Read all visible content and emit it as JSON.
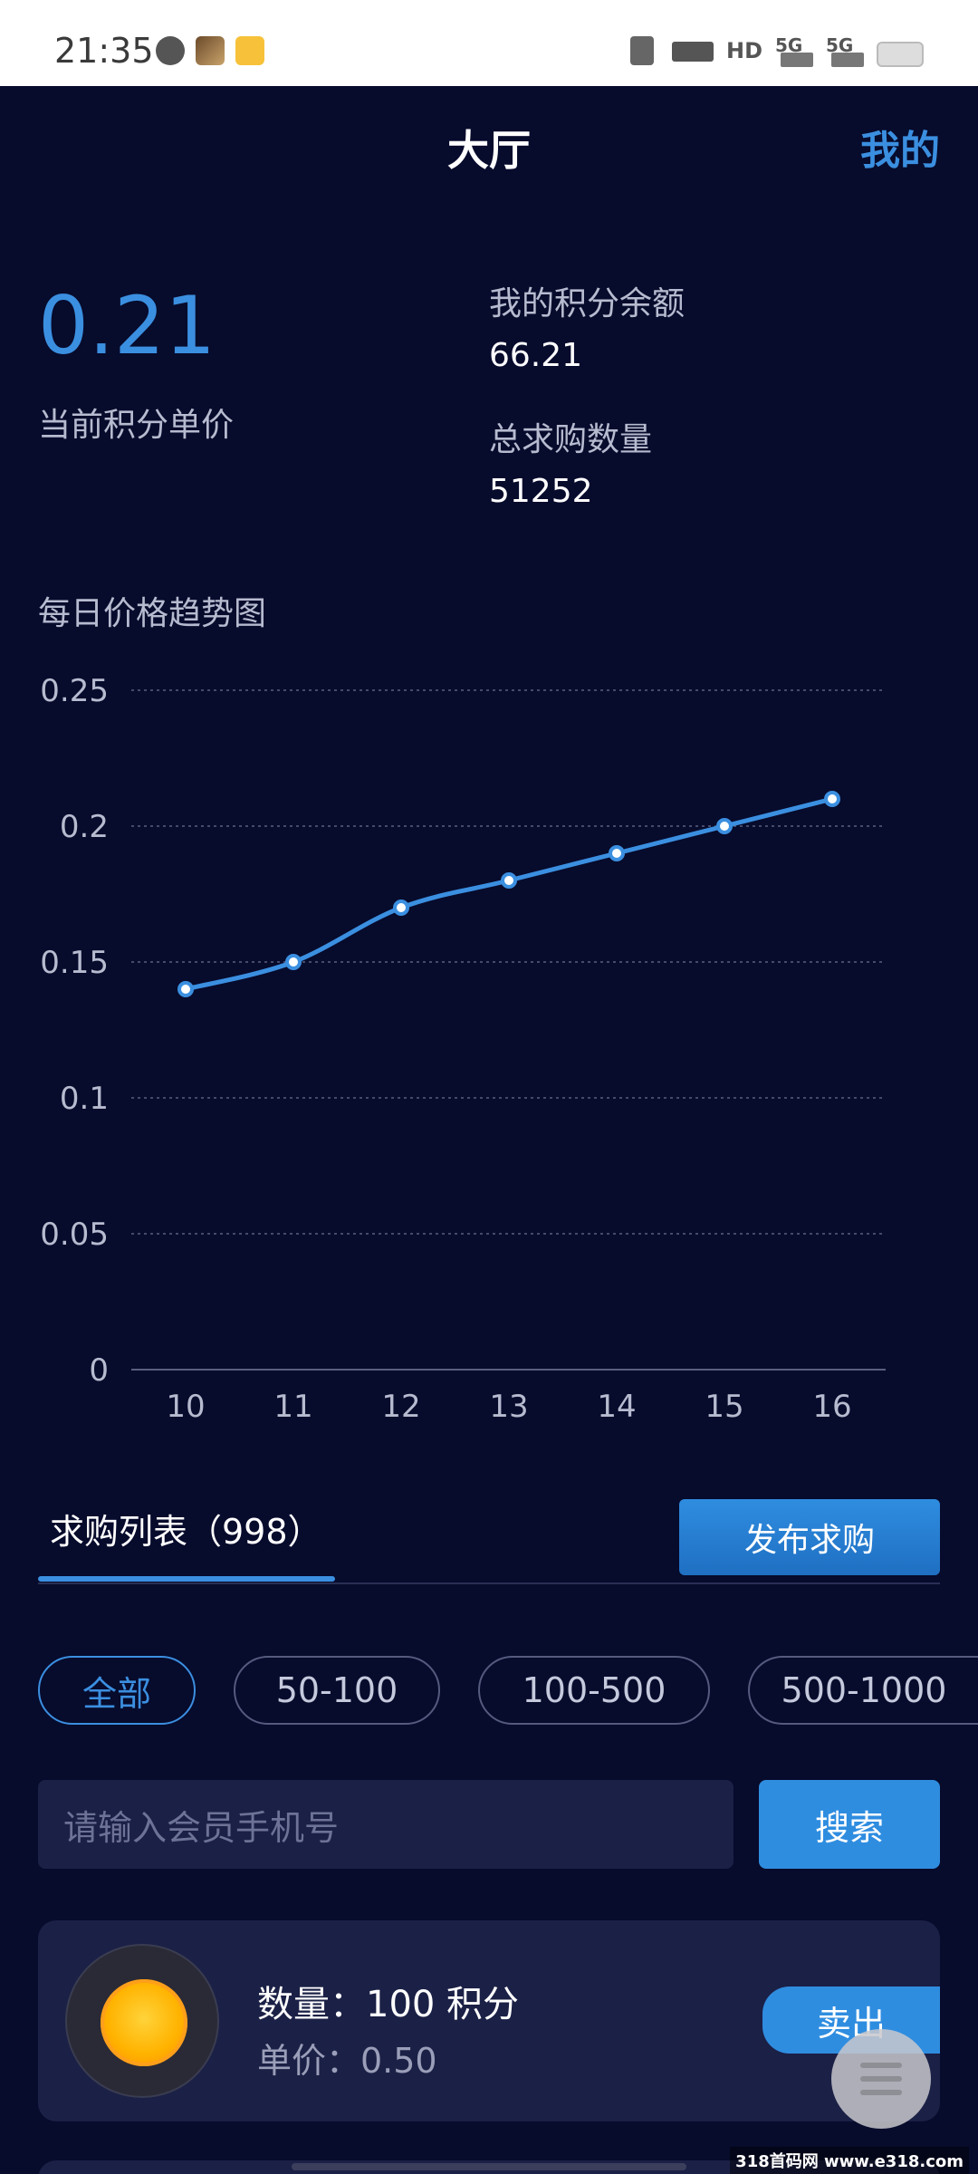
{
  "status_bar": {
    "time": "21:35",
    "network_text": "5G",
    "network_text_2": "5G",
    "hd_text": "HD"
  },
  "nav": {
    "title": "大厅",
    "mine": "我的"
  },
  "summary": {
    "price_value": "0.21",
    "price_label": "当前积分单价",
    "balance_label": "我的积分余额",
    "balance_value": "66.21",
    "total_label": "总求购数量",
    "total_value": "51252"
  },
  "chart_title": "每日价格趋势图",
  "chart_data": {
    "type": "line",
    "x": [
      "10",
      "11",
      "12",
      "13",
      "14",
      "15",
      "16"
    ],
    "series": [
      {
        "values": [
          0.14,
          0.15,
          0.17,
          0.18,
          0.19,
          0.2,
          0.21
        ]
      }
    ],
    "yticks": [
      "0",
      "0.05",
      "0.1",
      "0.15",
      "0.2",
      "0.25"
    ],
    "ylim": [
      0,
      0.25
    ],
    "grid": true,
    "color": "#3b8fe0"
  },
  "list": {
    "tab_label": "求购列表（998）",
    "publish_label": "发布求购"
  },
  "filters": [
    {
      "label": "全部",
      "active": true
    },
    {
      "label": "50-100",
      "active": false
    },
    {
      "label": "100-500",
      "active": false
    },
    {
      "label": "500-1000",
      "active": false
    }
  ],
  "search": {
    "placeholder": "请输入会员手机号",
    "button_label": "搜索"
  },
  "card": {
    "qty_text": "数量：100 积分",
    "price_text": "单价：0.50",
    "sell_label": "卖出"
  },
  "watermark": "318首码网 www.e318.com",
  "colors": {
    "background": "#070b2c",
    "accent": "#3b8fe0",
    "card": "#1b2046"
  }
}
